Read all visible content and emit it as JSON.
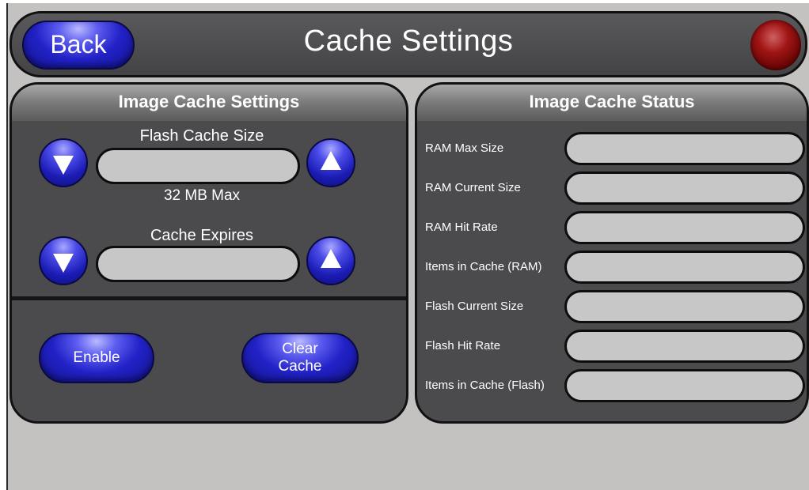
{
  "header": {
    "title": "Cache Settings",
    "back_label": "Back"
  },
  "image_cache_settings": {
    "title": "Image Cache Settings",
    "flash_cache_size": {
      "label": "Flash Cache Size",
      "value": "",
      "note": "32 MB Max"
    },
    "cache_expires": {
      "label": "Cache Expires",
      "value": ""
    },
    "enable_label": "Enable",
    "clear_cache_line1": "Clear",
    "clear_cache_line2": "Cache"
  },
  "image_cache_status": {
    "title": "Image Cache Status",
    "items": [
      {
        "label": "RAM Max Size",
        "value": ""
      },
      {
        "label": "RAM Current Size",
        "value": ""
      },
      {
        "label": "RAM Hit Rate",
        "value": ""
      },
      {
        "label": "Items in Cache (RAM)",
        "value": ""
      },
      {
        "label": "Flash Current Size",
        "value": ""
      },
      {
        "label": "Flash Hit Rate",
        "value": ""
      },
      {
        "label": "Items in Cache (Flash)",
        "value": ""
      }
    ]
  },
  "colors": {
    "background": "#c4c1c1",
    "panel": "#4b4b4d",
    "button_blue": "#2222c8",
    "status_led_red": "#a01515",
    "display_gray": "#c7c7c7"
  },
  "icons": {
    "decrease": "down-triangle-icon",
    "increase": "up-triangle-icon",
    "status": "status-led"
  }
}
